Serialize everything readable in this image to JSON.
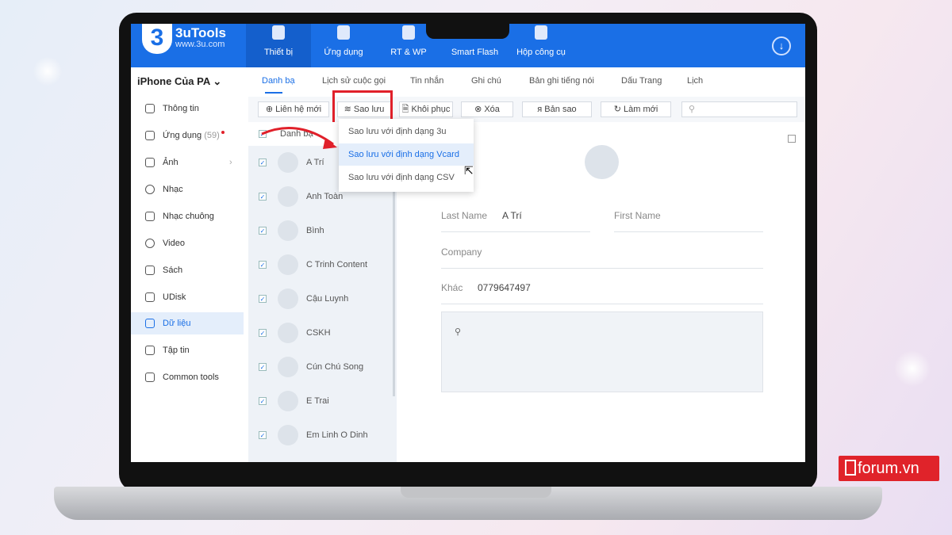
{
  "app": {
    "logo": "3",
    "brand": "3uTools",
    "url": "www.3u.com"
  },
  "nav": [
    {
      "label": "Thiết bị"
    },
    {
      "label": "Ứng dụng"
    },
    {
      "label": "RT & WP"
    },
    {
      "label": "Smart Flash"
    },
    {
      "label": "Hộp công cụ"
    }
  ],
  "device": "iPhone Của PA ⌄",
  "sidebar": [
    {
      "label": "Thông tin"
    },
    {
      "label": "Ứng dụng",
      "badge": "(59)"
    },
    {
      "label": "Ảnh"
    },
    {
      "label": "Nhạc"
    },
    {
      "label": "Nhạc chuông"
    },
    {
      "label": "Video"
    },
    {
      "label": "Sách"
    },
    {
      "label": "UDisk"
    },
    {
      "label": "Dữ liệu"
    },
    {
      "label": "Tập tin"
    },
    {
      "label": "Common tools"
    }
  ],
  "subtabs": [
    "Danh bạ",
    "Lịch sử cuộc gọi",
    "Tin nhắn",
    "Ghi chú",
    "Bản ghi tiếng nói",
    "Dấu Trang",
    "Lịch"
  ],
  "toolbar": {
    "new": "⊕ Liên hệ mới",
    "backup": "≋ Sao lưu",
    "restore": "🗎 Khôi phục",
    "delete": "⊗ Xóa",
    "copy": "ᴙ Bản sao",
    "refresh": "↻ Làm mới",
    "search_icon": "⚲"
  },
  "list": {
    "header": "Danh bạ",
    "contacts": [
      "A Trí",
      "Anh Toàn",
      "Bình",
      "C Trinh Content",
      "Cậu Luynh",
      "CSKH",
      "Cún Chú Song",
      "E Trai",
      "Em Linh O Dinh"
    ]
  },
  "menu": [
    "Sao lưu với định dạng 3u",
    "Sao lưu với định dạng Vcard",
    "Sao lưu với định dạng CSV"
  ],
  "detail": {
    "last_name_label": "Last Name",
    "last_name": "A Trí",
    "first_name_label": "First Name",
    "company_label": "Company",
    "other_label": "Khác",
    "phone": "0779647497",
    "note_icon": "⚲"
  },
  "watermark": "forum.vn",
  "colors": {
    "accent": "#1a6fe6",
    "highlight": "#e0202a"
  }
}
